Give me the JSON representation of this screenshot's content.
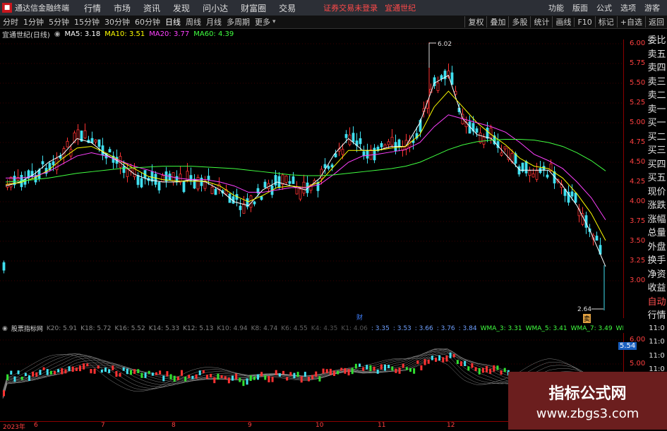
{
  "titlebar": {
    "app_name": "通达信金融终端",
    "menu": [
      "行情",
      "市场",
      "资讯",
      "发现",
      "问小达",
      "财富圈",
      "交易"
    ],
    "warning": "证券交易未登录",
    "stock_name": "宜通世纪",
    "right": [
      "功能",
      "版面",
      "公式",
      "选项",
      "游客"
    ]
  },
  "periodbar": {
    "periods": [
      "分时",
      "1分钟",
      "5分钟",
      "15分钟",
      "30分钟",
      "60分钟",
      "日线",
      "周线",
      "月线",
      "多周期",
      "更多"
    ],
    "active": "日线",
    "right_buttons": [
      "复权",
      "叠加",
      "多股",
      "统计",
      "画线",
      "F10",
      "标记",
      "+自选",
      "返回"
    ]
  },
  "infobar": {
    "title": "宜通世纪(日线)",
    "ma5": "MA5: 3.18",
    "ma10": "MA10: 3.51",
    "ma20": "MA20: 3.77",
    "ma60": "MA60: 4.39",
    "colors": {
      "ma5": "#ffffff",
      "ma10": "#ffff00",
      "ma20": "#ff40ff",
      "ma60": "#40ff40"
    }
  },
  "quote_panel": [
    "委比",
    "卖五",
    "卖四",
    "卖三",
    "卖二",
    "卖一",
    "买一",
    "买二",
    "买三",
    "买四",
    "买五",
    "现价",
    "涨跌",
    "涨幅",
    "总量",
    "外盘",
    "换手",
    "净资",
    "收益",
    "自动",
    "行情",
    "11:0",
    "11:0",
    "11:0",
    "11:0"
  ],
  "price_axis": [
    "6.00",
    "5.75",
    "5.50",
    "5.25",
    "5.00",
    "4.75",
    "4.50",
    "4.25",
    "4.00",
    "3.75",
    "3.50",
    "3.25",
    "3.00"
  ],
  "annotations": {
    "high": "6.02",
    "low": "2.64",
    "cai": "财",
    "sell_mark": "卖"
  },
  "indicator_bar": {
    "name": "股票指标网",
    "items": [
      "K20: 5.91",
      "K18: 5.72",
      "K16: 5.52",
      "K14: 5.33",
      "K12: 5.13",
      "K10: 4.94",
      "K8: 4.74",
      "K6: 4.55",
      "K4: 4.35",
      "K1: 4.06",
      ": 3.35",
      ": 3.53",
      ": 3.66",
      ": 3.76",
      ": 3.84",
      "WMA_3: 3.31",
      "WMA_5: 3.41",
      "WMA_7: 3.49",
      "WMA_9:"
    ]
  },
  "sub_axis": [
    "6.00",
    "5.54",
    "5.00"
  ],
  "date_axis": [
    "2023年",
    "6",
    "7",
    "8",
    "9",
    "10",
    "11",
    "12"
  ],
  "watermark": {
    "line1": "指标公式网",
    "line2": "www.zbgs3.com"
  },
  "chart_data": {
    "type": "candlestick",
    "title": "宜通世纪(日线)",
    "ylim": [
      2.6,
      6.1
    ],
    "series": [
      {
        "name": "MA5",
        "values": [
          4.2,
          4.25,
          4.35,
          4.5,
          4.6,
          4.8,
          4.75,
          4.6,
          4.5,
          4.35,
          4.28,
          4.25,
          4.25,
          4.28,
          4.25,
          4.15,
          4.0,
          3.95,
          4.15,
          4.25,
          4.2,
          4.15,
          4.3,
          4.6,
          4.8,
          4.65,
          4.65,
          4.7,
          4.7,
          5.0,
          5.5,
          5.6,
          5.05,
          4.85,
          4.8,
          4.6,
          4.4,
          4.4,
          4.4,
          4.2,
          3.95,
          3.6,
          3.18
        ]
      },
      {
        "name": "MA10",
        "values": [
          4.22,
          4.24,
          4.3,
          4.4,
          4.55,
          4.68,
          4.7,
          4.62,
          4.52,
          4.42,
          4.32,
          4.28,
          4.26,
          4.26,
          4.26,
          4.2,
          4.08,
          4.0,
          4.08,
          4.18,
          4.2,
          4.18,
          4.25,
          4.45,
          4.65,
          4.65,
          4.65,
          4.68,
          4.7,
          4.85,
          5.2,
          5.4,
          5.2,
          5.0,
          4.85,
          4.72,
          4.55,
          4.45,
          4.42,
          4.3,
          4.1,
          3.85,
          3.51
        ]
      },
      {
        "name": "MA20",
        "values": [
          4.3,
          4.3,
          4.32,
          4.38,
          4.48,
          4.58,
          4.62,
          4.58,
          4.52,
          4.45,
          4.4,
          4.34,
          4.3,
          4.28,
          4.28,
          4.25,
          4.2,
          4.12,
          4.12,
          4.15,
          4.18,
          4.18,
          4.22,
          4.35,
          4.5,
          4.58,
          4.6,
          4.63,
          4.66,
          4.75,
          4.95,
          5.1,
          5.05,
          5.0,
          4.95,
          4.88,
          4.75,
          4.6,
          4.52,
          4.42,
          4.25,
          4.05,
          3.77
        ]
      },
      {
        "name": "MA60",
        "values": [
          4.25,
          4.26,
          4.28,
          4.3,
          4.33,
          4.36,
          4.38,
          4.4,
          4.42,
          4.43,
          4.44,
          4.45,
          4.45,
          4.45,
          4.44,
          4.43,
          4.42,
          4.4,
          4.38,
          4.36,
          4.34,
          4.33,
          4.33,
          4.34,
          4.36,
          4.38,
          4.4,
          4.42,
          4.45,
          4.5,
          4.58,
          4.66,
          4.72,
          4.76,
          4.78,
          4.79,
          4.79,
          4.78,
          4.75,
          4.7,
          4.62,
          4.52,
          4.39
        ]
      }
    ]
  }
}
